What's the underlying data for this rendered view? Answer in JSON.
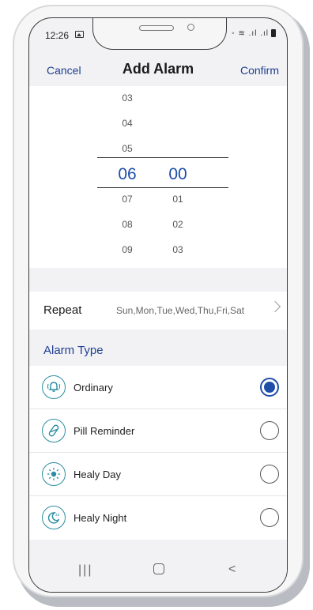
{
  "status_bar": {
    "time": "12:26",
    "right": "◦ ≋ .ıl .ıl"
  },
  "header": {
    "cancel": "Cancel",
    "title": "Add Alarm",
    "confirm": "Confirm"
  },
  "picker": {
    "hours": [
      "03",
      "04",
      "05",
      "06",
      "07",
      "08",
      "09"
    ],
    "minutes": [
      "00",
      "01",
      "02",
      "03"
    ],
    "selected_hour": "06",
    "selected_minute": "00"
  },
  "repeat": {
    "label": "Repeat",
    "value": "Sun,Mon,Tue,Wed,Thu,Fri,Sat"
  },
  "alarm_type": {
    "title": "Alarm Type",
    "items": [
      {
        "label": "Ordinary",
        "icon": "bell-icon",
        "selected": true
      },
      {
        "label": "Pill Reminder",
        "icon": "pill-icon",
        "selected": false
      },
      {
        "label": "Healy Day",
        "icon": "sun-icon",
        "selected": false
      },
      {
        "label": "Healy Night",
        "icon": "moon-icon",
        "selected": false
      }
    ]
  },
  "colors": {
    "accent": "#1e4ea8",
    "icon": "#2a8ea0"
  },
  "navbar": {
    "recent": "|||",
    "back": "<"
  }
}
